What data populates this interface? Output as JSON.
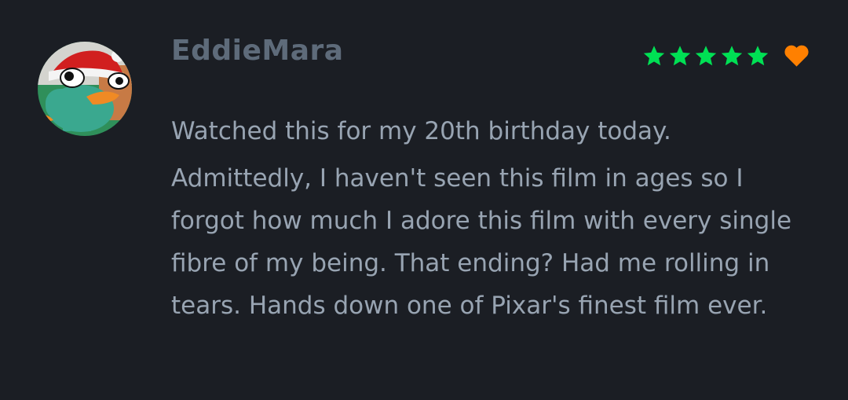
{
  "review": {
    "username": "EddieMara",
    "rating": {
      "stars": 5,
      "max": 5,
      "star_color": "#00e054",
      "liked": true,
      "like_color": "#ff8000"
    },
    "paragraphs": [
      "Watched this for my 20th birthday today.",
      "Admittedly, I haven't seen this film in ages so I forgot how much I adore this film with every single fibre of my being. That ending? Had me rolling in tears. Hands down one of Pixar's finest film ever."
    ]
  },
  "icons": {
    "avatar": "perry-platypus-santa-hat-avatar",
    "star": "star-icon",
    "like": "heart-icon"
  },
  "colors": {
    "background": "#1b1e24",
    "username": "#5e6b7a",
    "body_text": "#98a4b2"
  }
}
